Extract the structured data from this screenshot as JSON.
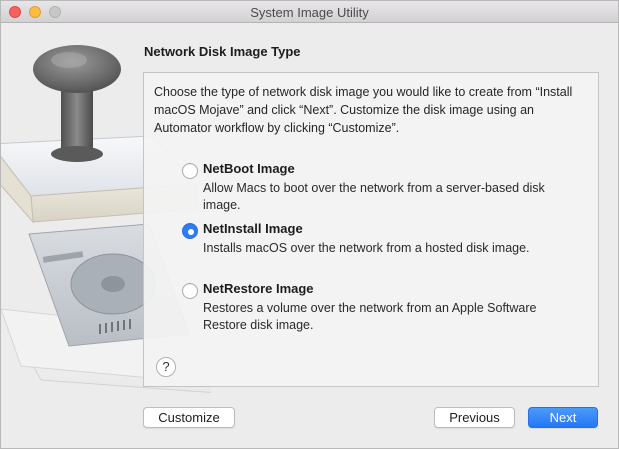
{
  "window": {
    "title": "System Image Utility"
  },
  "page": {
    "heading": "Network Disk Image Type",
    "intro": "Choose the type of network disk image you would like to create from “Install macOS Mojave” and click “Next”. Customize the disk image using an Automator workflow by clicking “Customize”."
  },
  "options": [
    {
      "title": "NetBoot Image",
      "desc": "Allow Macs to boot over the network from a server-based disk image.",
      "selected": false
    },
    {
      "title": "NetInstall Image",
      "desc": "Installs macOS over the network from a hosted disk image.",
      "selected": true
    },
    {
      "title": "NetRestore Image",
      "desc": "Restores a volume over the network from an Apple Software Restore disk image.",
      "selected": false
    }
  ],
  "help": {
    "label": "?"
  },
  "buttons": {
    "customize": "Customize",
    "previous": "Previous",
    "next": "Next"
  },
  "colors": {
    "accent": "#2f7cf6",
    "close": "#fc605b",
    "minimize": "#fdbc40",
    "zoom": "#c7c7c7"
  },
  "icons": {
    "illustration": "disk-image-stamp-icon"
  }
}
